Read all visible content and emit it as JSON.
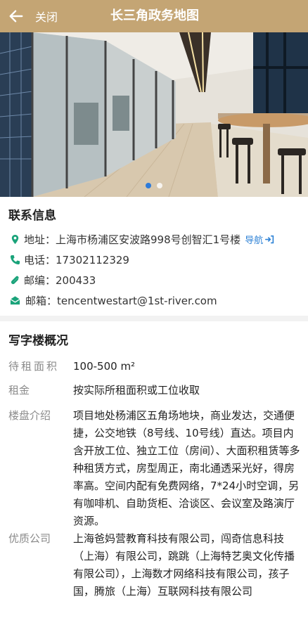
{
  "header": {
    "back_label": "关闭",
    "title": "长三角政务地图",
    "background_color": "#c4a574"
  },
  "carousel": {
    "slide_count": 2,
    "active_index": 0
  },
  "contact": {
    "section_title": "联系信息",
    "address": "地址：上海市杨浦区安波路998号创智汇1号楼",
    "nav_label": "导航",
    "phone": "电话：17302112329",
    "postcode": "邮编：200433",
    "email": "邮箱：tencentwestart@1st-river.com",
    "icon_color": "#1aa37a",
    "link_color": "#2e82d6"
  },
  "overview": {
    "section_title": "写字楼概况",
    "rows": [
      {
        "label": "待租面积",
        "value": "100-500 m²"
      },
      {
        "label": "租金",
        "value": "按实际所租面积或工位收取"
      },
      {
        "label": "楼盘介绍",
        "value": "项目地处杨浦区五角场地块，商业发达，交通便捷，公交地铁（8号线、10号线）直达。项目内含开放工位、独立工位（房间）、大面积租赁等多种租赁方式，房型周正，南北通透采光好，得房率高。空间内配有免费网络，7*24小时空调，另有咖啡机、自助货柜、洽谈区、会议室及路演厅资源。"
      },
      {
        "label": "优质公司",
        "value": "上海爸妈营教育科技有限公司，闯奇信息科技（上海）有限公司，跳跳（上海特艺奥文化传播有限公司），上海数才网络科技有限公司，孩子国，腾旅（上海）互联网科技有限公司"
      }
    ]
  }
}
